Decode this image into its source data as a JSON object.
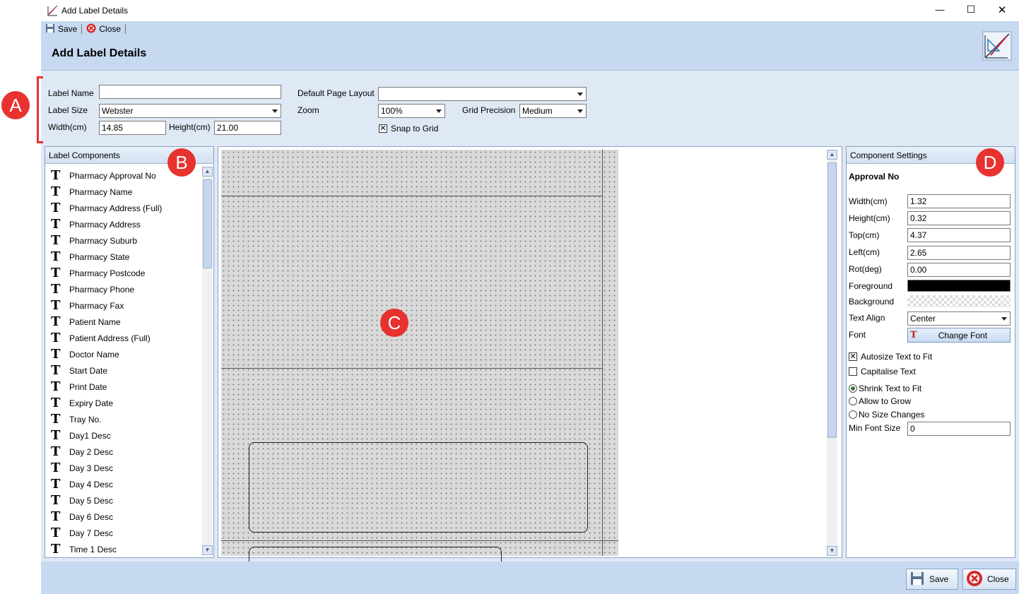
{
  "window": {
    "title": "Add Label Details",
    "minimize_glyph": "—",
    "maximize_glyph": "☐",
    "close_glyph": "✕"
  },
  "toolbar": {
    "save_label": "Save",
    "close_label": "Close"
  },
  "header": {
    "title": "Add Label Details"
  },
  "form": {
    "label_name_label": "Label Name",
    "label_name_value": "",
    "label_size_label": "Label Size",
    "label_size_value": "Webster",
    "width_label": "Width(cm)",
    "width_value": "14.85",
    "height_label": "Height(cm)",
    "height_value": "21.00",
    "default_page_layout_label": "Default Page Layout",
    "default_page_layout_value": "",
    "zoom_label": "Zoom",
    "zoom_value": "100%",
    "grid_precision_label": "Grid Precision",
    "grid_precision_value": "Medium",
    "snap_to_grid_label": "Snap to Grid",
    "snap_to_grid_checked": true,
    "check_glyph": "✕"
  },
  "components": {
    "title": "Label Components",
    "icon_glyph": "T",
    "items": [
      "Pharmacy Approval No",
      "Pharmacy Name",
      "Pharmacy Address (Full)",
      "Pharmacy Address",
      "Pharmacy Suburb",
      "Pharmacy State",
      "Pharmacy Postcode",
      "Pharmacy Phone",
      "Pharmacy Fax",
      "Patient Name",
      "Patient Address (Full)",
      "Doctor Name",
      "Start Date",
      "Print Date",
      "Expiry Date",
      "Tray No.",
      "Day1 Desc",
      "Day 2 Desc",
      "Day 3 Desc",
      "Day 4 Desc",
      "Day 5 Desc",
      "Day 6 Desc",
      "Day 7 Desc",
      "Time 1 Desc"
    ]
  },
  "settings": {
    "title": "Component Settings",
    "component_name": "Approval No",
    "width_label": "Width(cm)",
    "width_value": "1.32",
    "height_label": "Height(cm)",
    "height_value": "0.32",
    "top_label": "Top(cm)",
    "top_value": "4.37",
    "left_label": "Left(cm)",
    "left_value": "2.65",
    "rot_label": "Rot(deg)",
    "rot_value": "0.00",
    "foreground_label": "Foreground",
    "foreground_color": "#000000",
    "background_label": "Background",
    "text_align_label": "Text Align",
    "text_align_value": "Center",
    "font_label": "Font",
    "change_font_label": "Change Font",
    "autosize_label": "Autosize Text to Fit",
    "autosize_checked": true,
    "capitalise_label": "Capitalise Text",
    "capitalise_checked": false,
    "shrink_label": "Shrink Text to Fit",
    "allow_grow_label": "Allow to Grow",
    "no_size_label": "No Size Changes",
    "size_mode": "shrink",
    "min_font_label": "Min Font Size",
    "min_font_value": "0"
  },
  "footer": {
    "save_label": "Save",
    "close_label": "Close"
  },
  "markers": {
    "a": "A",
    "b": "B",
    "c": "C",
    "d": "D"
  },
  "colors": {
    "accent": "#c6d9f0",
    "marker": "#e8322f",
    "bracket": "#e8322f"
  }
}
